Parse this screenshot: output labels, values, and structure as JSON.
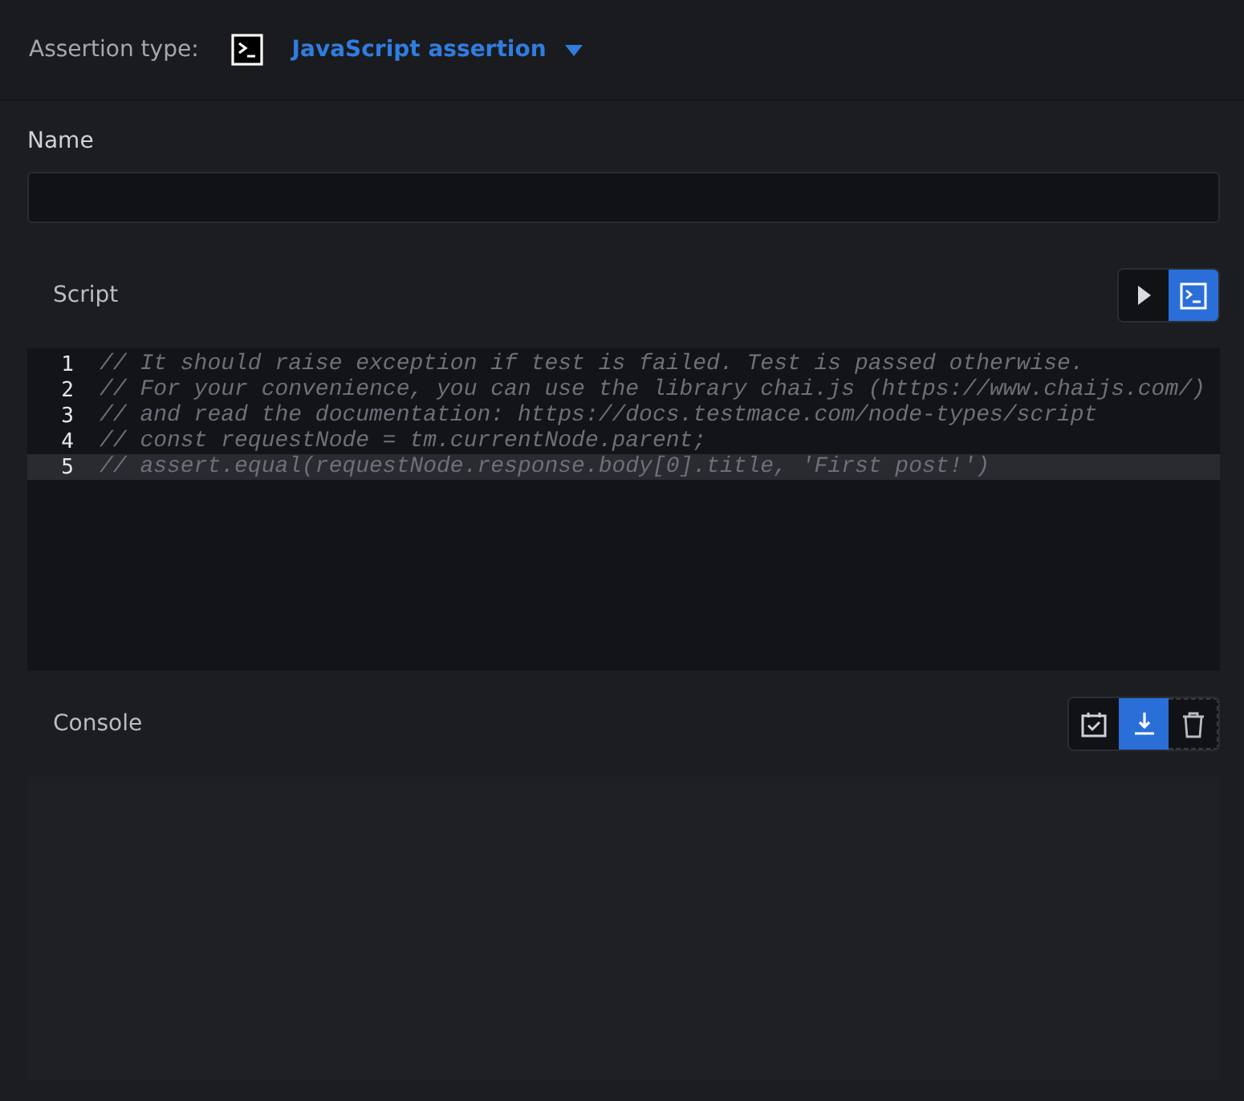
{
  "assertion_type": {
    "label": "Assertion type:",
    "value": "JavaScript assertion"
  },
  "name_field": {
    "label": "Name"
  },
  "script": {
    "label": "Script",
    "buttons": [
      {
        "kind": "run",
        "selected": false
      },
      {
        "kind": "terminal",
        "selected": true
      }
    ],
    "lines": [
      {
        "number": "1",
        "text": "// It should raise exception if test is failed. Test is passed otherwise.",
        "active": false
      },
      {
        "number": "2",
        "text": "// For your convenience, you can use the library chai.js (https://www.chaijs.com/)",
        "active": false
      },
      {
        "number": "3",
        "text": "// and read the documentation: https://docs.testmace.com/node-types/script",
        "active": false
      },
      {
        "number": "4",
        "text": "// const requestNode = tm.currentNode.parent;",
        "active": false
      },
      {
        "number": "5",
        "text": "// assert.equal(requestNode.response.body[0].title, 'First post!')",
        "active": true
      }
    ]
  },
  "console": {
    "label": "Console",
    "buttons": [
      {
        "kind": "calendar",
        "selected": false
      },
      {
        "kind": "download",
        "selected": true
      },
      {
        "kind": "trash",
        "selected": false
      }
    ]
  }
}
